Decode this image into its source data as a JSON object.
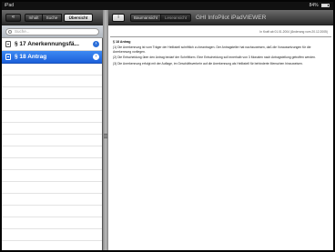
{
  "status_bar": {
    "carrier": "iPad",
    "clock": "",
    "battery": "84%"
  },
  "left_pane": {
    "back_button": "«",
    "tabs": [
      {
        "label": "Inhalt"
      },
      {
        "label": "Suche"
      },
      {
        "label": "Übersicht",
        "selected": true
      }
    ],
    "search_placeholder": "Suche...",
    "items": [
      {
        "label": "§ 17  Anerkennungsfä...",
        "selected": false,
        "chevron": "›"
      },
      {
        "label": "§ 18  Antrag",
        "selected": true,
        "chevron": "›"
      }
    ]
  },
  "right_pane": {
    "info_button": "i",
    "tabs": [
      {
        "label": "Baumansicht"
      },
      {
        "label": "Leseansicht"
      }
    ],
    "title": "GHI InfoPilot iPadVIEWER",
    "document": {
      "meta": "In Kraft ab 01.01.2004 (Änderung vom 20.12.2005)",
      "heading": "§ 18  Antrag",
      "paragraphs": [
        "(1) Die Anerkennung ist vom Träger der Heilkstell schriftlich zu beantragen. Der Antragsteller hat nachzuweisen, daß die Voraussetzungen für die Anerkennung vorliegen.",
        "(2) Die Entscheidung über den Antrag bedarf der Schriftform. Eine Entscheidung soll innerhalb von 3 Monaten nach Antragstellung getroffen werden.",
        "(3) Die Anerkennung erfolgt mit der Auflage, im Geschäftsverkehr auf die Anerkennung als Heilkstell für behinderte Menschen hinzuweisen."
      ]
    }
  },
  "colors": {
    "selection": "#1b5fd9",
    "toolbar": "#2b2b2b"
  }
}
